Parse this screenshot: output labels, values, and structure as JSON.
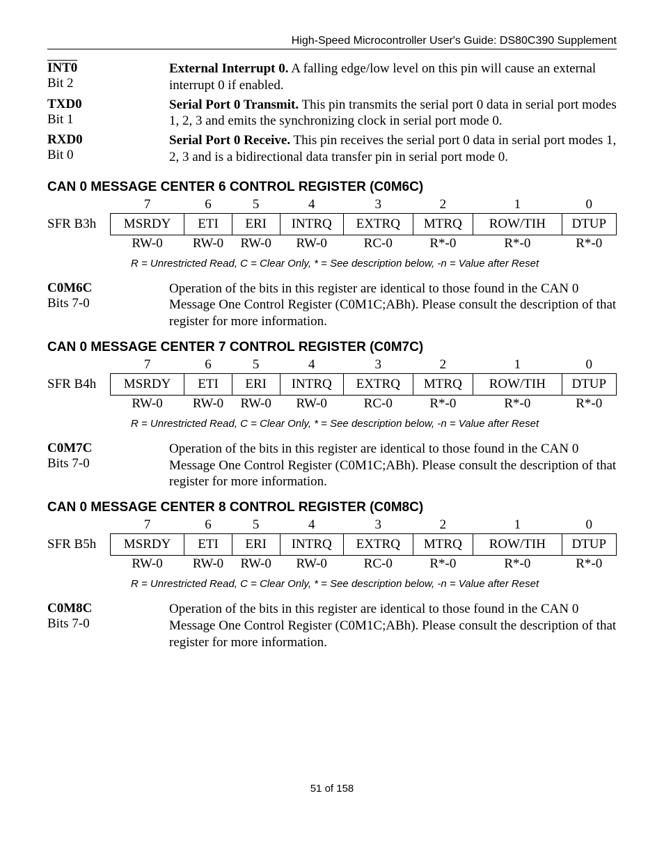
{
  "header": "High-Speed Microcontroller User's Guide: DS80C390 Supplement",
  "pins": [
    {
      "name": "INT0",
      "overline": true,
      "bit": "Bit 2",
      "desc_bold": "External Interrupt 0.",
      "desc": " A falling edge/low level on this pin will cause an external interrupt 0 if enabled."
    },
    {
      "name": "TXD0",
      "overline": false,
      "bit": "Bit 1",
      "desc_bold": "Serial Port 0 Transmit.",
      "desc": " This pin transmits the serial port 0 data in serial port modes 1, 2, 3 and emits the synchronizing clock in serial port mode 0."
    },
    {
      "name": "RXD0",
      "overline": false,
      "bit": "Bit 0",
      "desc_bold": "Serial Port 0 Receive.",
      "desc": " This pin receives the serial port 0 data in serial port modes 1, 2, 3 and is a bidirectional data transfer pin in serial port mode 0."
    }
  ],
  "registers": [
    {
      "title": "CAN 0 MESSAGE CENTER 6 CONTROL REGISTER (C0M6C)",
      "sfr": "SFR B3h",
      "bitnums": [
        "7",
        "6",
        "5",
        "4",
        "3",
        "2",
        "1",
        "0"
      ],
      "bitnames": [
        "MSRDY",
        "ETI",
        "ERI",
        "INTRQ",
        "EXTRQ",
        "MTRQ",
        "ROW/TIH",
        "DTUP"
      ],
      "access": [
        "RW-0",
        "RW-0",
        "RW-0",
        "RW-0",
        "RC-0",
        "R*-0",
        "R*-0",
        "R*-0"
      ],
      "legend": "R = Unrestricted Read, C = Clear Only, * = See description below, -n = Value after Reset",
      "desc_name": "C0M6C",
      "desc_bits": "Bits 7-0",
      "desc_text": "Operation of the bits in this register are identical to those found in the CAN 0 Message One Control Register (C0M1C;ABh). Please consult the description of that register for more information."
    },
    {
      "title": "CAN 0 MESSAGE CENTER 7 CONTROL REGISTER (C0M7C)",
      "sfr": "SFR B4h",
      "bitnums": [
        "7",
        "6",
        "5",
        "4",
        "3",
        "2",
        "1",
        "0"
      ],
      "bitnames": [
        "MSRDY",
        "ETI",
        "ERI",
        "INTRQ",
        "EXTRQ",
        "MTRQ",
        "ROW/TIH",
        "DTUP"
      ],
      "access": [
        "RW-0",
        "RW-0",
        "RW-0",
        "RW-0",
        "RC-0",
        "R*-0",
        "R*-0",
        "R*-0"
      ],
      "legend": "R = Unrestricted Read, C = Clear Only, * = See description below, -n = Value after Reset",
      "desc_name": "C0M7C",
      "desc_bits": "Bits 7-0",
      "desc_text": "Operation of the bits in this register are identical to those found in the CAN 0 Message One Control Register (C0M1C;ABh). Please consult the description of that register for more information."
    },
    {
      "title": "CAN 0 MESSAGE CENTER 8 CONTROL REGISTER (C0M8C)",
      "sfr": "SFR B5h",
      "bitnums": [
        "7",
        "6",
        "5",
        "4",
        "3",
        "2",
        "1",
        "0"
      ],
      "bitnames": [
        "MSRDY",
        "ETI",
        "ERI",
        "INTRQ",
        "EXTRQ",
        "MTRQ",
        "ROW/TIH",
        "DTUP"
      ],
      "access": [
        "RW-0",
        "RW-0",
        "RW-0",
        "RW-0",
        "RC-0",
        "R*-0",
        "R*-0",
        "R*-0"
      ],
      "legend": "R = Unrestricted Read, C = Clear Only, * = See description below, -n = Value after Reset",
      "desc_name": "C0M8C",
      "desc_bits": "Bits 7-0",
      "desc_text": "Operation of the bits in this register are identical to those found in the CAN 0 Message One Control Register (C0M1C;ABh). Please consult the description of that register for more information."
    }
  ],
  "page_number": "51 of 158"
}
